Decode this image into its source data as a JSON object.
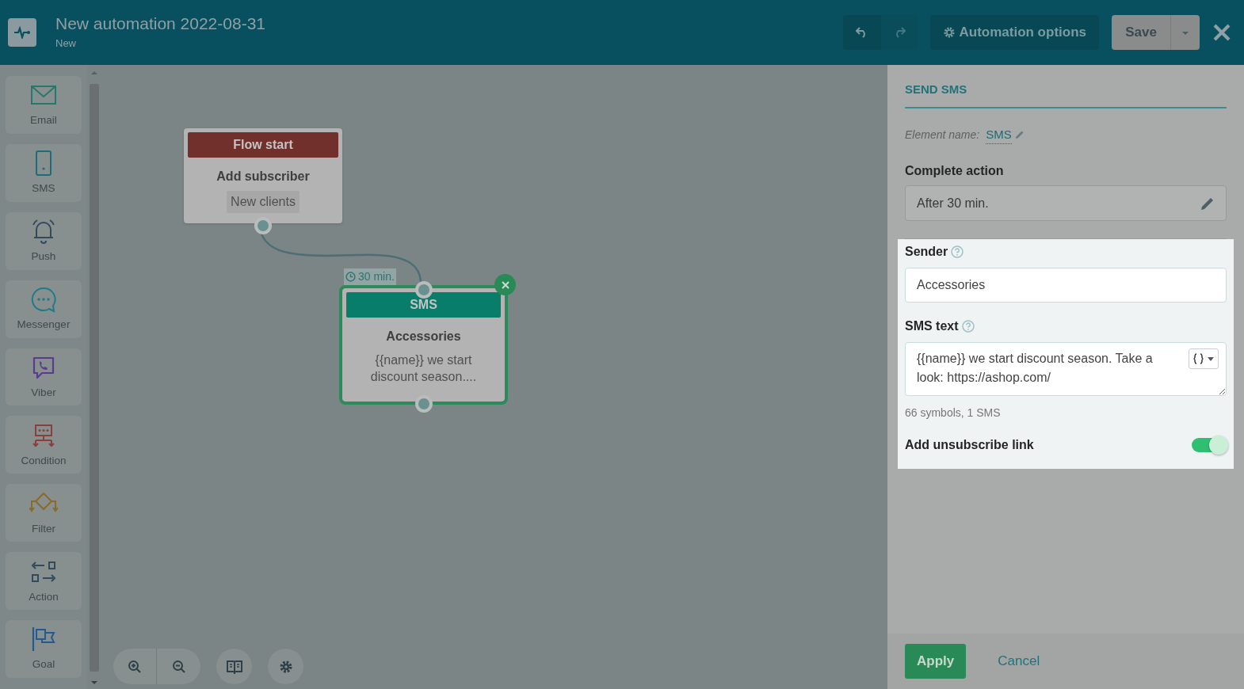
{
  "header": {
    "title": "New automation 2022-08-31",
    "subtitle": "New",
    "options_button": "Automation options",
    "save_button": "Save"
  },
  "palette": [
    {
      "kind": "email",
      "label": "Email"
    },
    {
      "kind": "sms",
      "label": "SMS"
    },
    {
      "kind": "push",
      "label": "Push"
    },
    {
      "kind": "messenger",
      "label": "Messenger"
    },
    {
      "kind": "viber",
      "label": "Viber"
    },
    {
      "kind": "condition",
      "label": "Condition"
    },
    {
      "kind": "filter",
      "label": "Filter"
    },
    {
      "kind": "action",
      "label": "Action"
    },
    {
      "kind": "goal",
      "label": "Goal"
    }
  ],
  "canvas": {
    "nodes": [
      {
        "kind": "start",
        "header": "Flow start",
        "title": "Add subscriber",
        "tag": "New clients",
        "selected": false
      },
      {
        "kind": "sms",
        "header": "SMS",
        "title": "Accessories",
        "text": "{{name}} we start discount season....",
        "delay": "30 min.",
        "selected": true
      }
    ]
  },
  "panel": {
    "title": "SEND SMS",
    "element_name_label": "Element name:",
    "element_name": "SMS",
    "complete_action_label": "Complete action",
    "complete_action_value": "After 30 min.",
    "sender_label": "Sender",
    "sender_value": "Accessories",
    "sms_text_label": "SMS text",
    "sms_text_value": "{{name}} we start discount season. Take a look: https://ashop.com/",
    "counter": "66 symbols, 1 SMS",
    "unsubscribe_label": "Add unsubscribe link",
    "unsubscribe_on": true
  },
  "footer": {
    "apply": "Apply",
    "cancel": "Cancel"
  }
}
